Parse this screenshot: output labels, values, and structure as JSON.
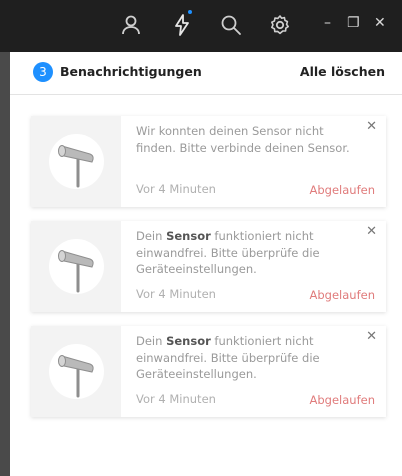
{
  "colors": {
    "accent": "#1e90ff",
    "expired": "#e07b7b",
    "titlebar": "#1f1f1f"
  },
  "titlebar": {
    "icons": [
      "user-icon",
      "lightning-icon",
      "search-icon",
      "gear-icon"
    ],
    "window_controls": {
      "minimize": "–",
      "restore": "❐",
      "close": "✕"
    }
  },
  "header": {
    "count": "3",
    "title": "Benachrichtigungen",
    "clear_all": "Alle löschen"
  },
  "notifications": [
    {
      "text_before": "Wir konnten deinen Sensor nicht finden. Bitte verbinde deinen Sensor.",
      "text_bold": "",
      "text_after": "",
      "time": "Vor 4 Minuten",
      "status": "Abgelaufen",
      "close": "✕"
    },
    {
      "text_before": "Dein ",
      "text_bold": "Sensor",
      "text_after": " funktioniert nicht einwandfrei. Bitte überprüfe die Geräteeinstellungen.",
      "time": "Vor 4 Minuten",
      "status": "Abgelaufen",
      "close": "✕"
    },
    {
      "text_before": "Dein ",
      "text_bold": "Sensor",
      "text_after": " funktioniert nicht einwandfrei. Bitte überprüfe die Geräteeinstellungen.",
      "time": "Vor 4 Minuten",
      "status": "Abgelaufen",
      "close": "✕"
    }
  ]
}
